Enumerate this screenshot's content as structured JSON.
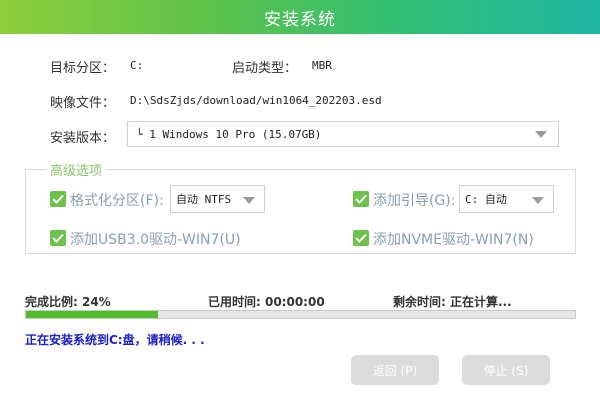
{
  "window": {
    "title": "安装系统"
  },
  "fields": {
    "target_partition_label": "目标分区：",
    "target_partition_value": "C:",
    "boot_type_label": "启动类型：",
    "boot_type_value": "MBR",
    "image_file_label": "映像文件：",
    "image_file_value": "D:\\SdsZjds/download/win1064_202203.esd",
    "edition_label": "安装版本：",
    "edition_value": "└ 1 Windows 10 Pro (15.07GB)"
  },
  "advanced": {
    "title": "高级选项",
    "format_partition": {
      "label": "格式化分区(F):",
      "checked": true,
      "select_value": "自动 NTFS"
    },
    "add_boot": {
      "label": "添加引导(G):",
      "checked": true,
      "select_value": "C: 自动"
    },
    "usb3_driver": {
      "label": "添加USB3.0驱动-WIN7(U)",
      "checked": true
    },
    "nvme_driver": {
      "label": "添加NVME驱动-WIN7(N)",
      "checked": true
    }
  },
  "progress": {
    "ratio_text": "完成比例: 24%",
    "ratio_value": 0.24,
    "elapsed_text": "已用时间: 00:00:00",
    "remaining_text": "剩余时间: 正在计算..."
  },
  "status_message": "正在安装系统到C:盘，请稍候. . .",
  "buttons": {
    "back": "返回 (P)",
    "stop": "停止 (S)"
  },
  "colors": {
    "accent_green": "#51bd2a",
    "status_blue": "#1b20c8",
    "disabled_button": "#dcdcdc"
  },
  "icons": {
    "checkbox": "checkmark-icon",
    "dropdown": "caret-down-icon"
  }
}
